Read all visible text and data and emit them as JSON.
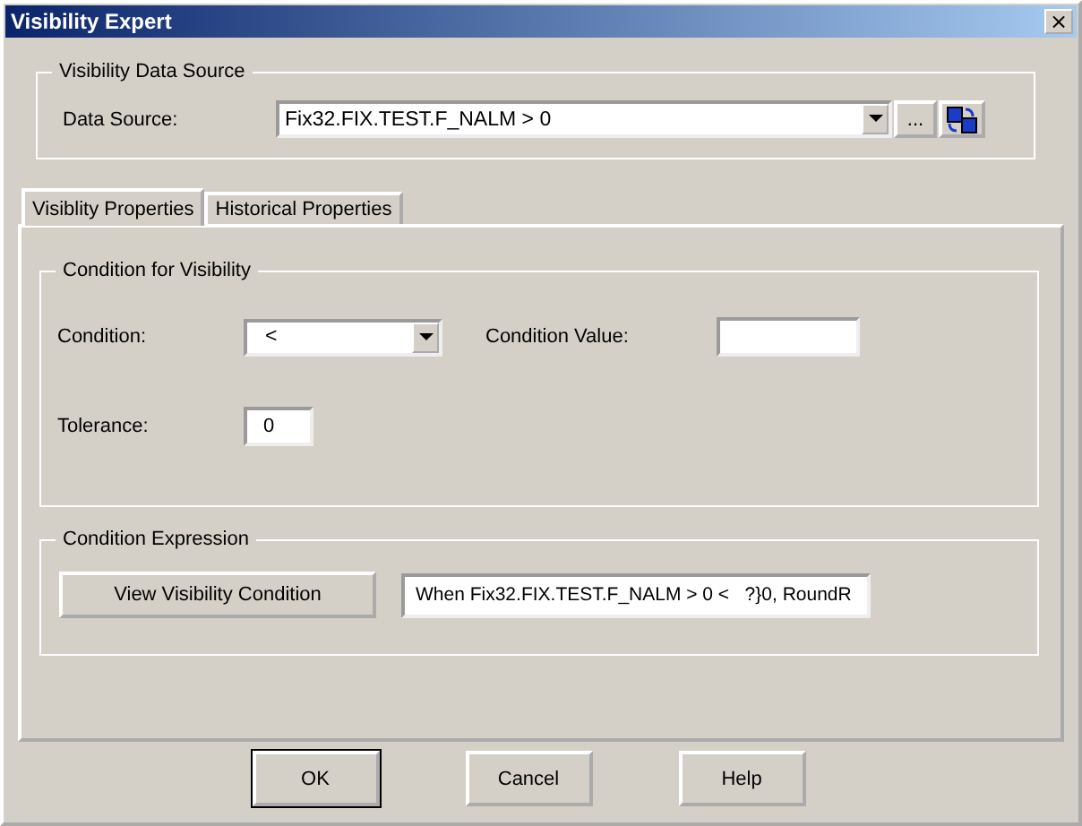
{
  "window": {
    "title": "Visibility Expert",
    "close": "×"
  },
  "data_source_group": {
    "legend": "Visibility Data Source",
    "label": "Data Source:",
    "value": "Fix32.FIX.TEST.F_NALM > 0",
    "browse": "..."
  },
  "tabs": [
    {
      "label": "Visiblity Properties",
      "selected": true
    },
    {
      "label": "Historical Properties",
      "selected": false
    }
  ],
  "condition_group": {
    "legend": "Condition for Visibility",
    "condition_label": "Condition:",
    "condition_value": "<",
    "value_label": "Condition Value:",
    "tolerance_label": "Tolerance:",
    "tolerance_value": "0"
  },
  "expression_group": {
    "legend": "Condition Expression",
    "button": "View Visibility Condition",
    "expression": "When Fix32.FIX.TEST.F_NALM > 0 <   ?}0, RoundR"
  },
  "buttons": [
    {
      "label": "OK",
      "default": true
    },
    {
      "label": "Cancel",
      "default": false
    },
    {
      "label": "Help",
      "default": false
    }
  ]
}
